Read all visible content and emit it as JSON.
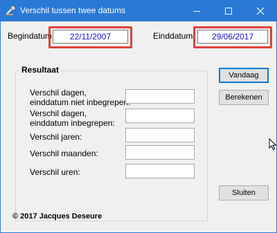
{
  "window": {
    "title": "Verschil tussen twee datums"
  },
  "dates": {
    "begin_label": "Begindatum:",
    "begin_value": "22/11/2007",
    "end_label": "Einddatum:",
    "end_value": "29/06/2017"
  },
  "result": {
    "group_title": "Resultaat",
    "rows": [
      {
        "label_line1": "Verschil dagen,",
        "label_line2": "einddatum niet inbegrepen:",
        "value": ""
      },
      {
        "label_line1": "Verschil dagen,",
        "label_line2": "einddatum inbegrepen:",
        "value": ""
      },
      {
        "label_line1": "Verschil jaren:",
        "value": ""
      },
      {
        "label_line1": "Verschil maanden:",
        "value": ""
      },
      {
        "label_line1": "Verschil uren:",
        "value": ""
      }
    ]
  },
  "buttons": {
    "today": "Vandaag",
    "calculate": "Berekenen",
    "close": "Sluiten"
  },
  "footer": {
    "copyright": "© 2017 Jacques Deseure"
  },
  "colors": {
    "titlebar": "#2b79d6",
    "highlight": "#e0403a",
    "date_text": "#1010c8"
  }
}
